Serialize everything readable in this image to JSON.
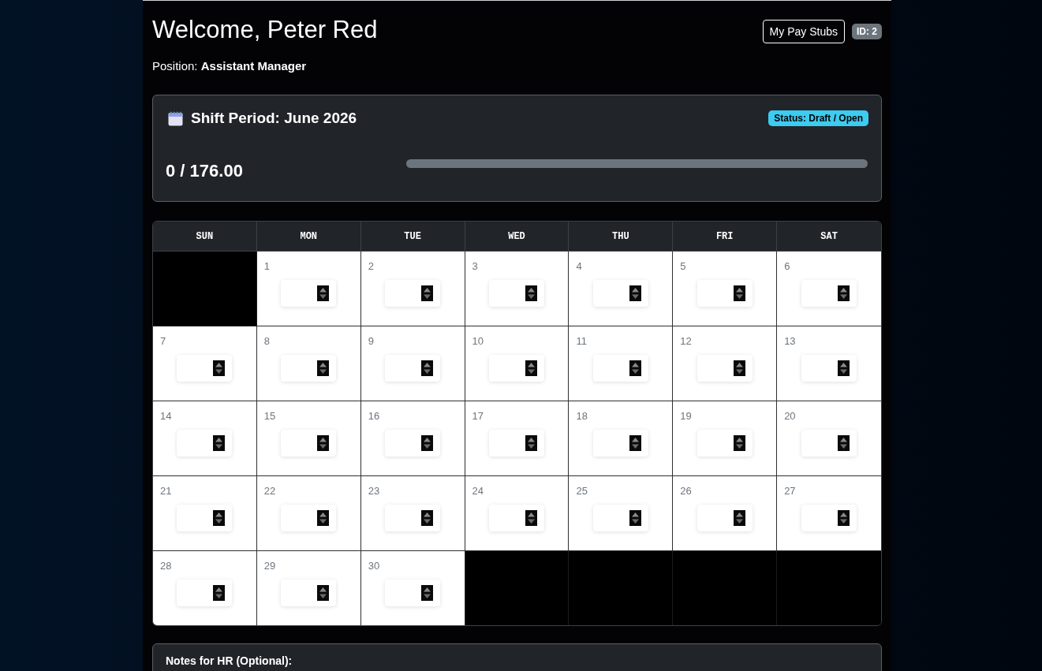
{
  "header": {
    "title": "Welcome, Peter Red",
    "position": "Position: **Assistant Manager**",
    "pay_stubs_button": "My Pay Stubs",
    "id_badge": "ID: 2"
  },
  "shift_card": {
    "title": "Shift Period: June 2026",
    "status": "Status: Draft / Open",
    "hours": "0 / 176.00",
    "progress": {
      "level": 0
    }
  },
  "calendar": {
    "weekdays": [
      "SUN",
      "MON",
      "TUE",
      "WED",
      "THU",
      "FRI",
      "SAT"
    ],
    "weeks": [
      [
        {
          "kind": "blank"
        },
        {
          "kind": "day",
          "day": "1"
        },
        {
          "kind": "day",
          "day": "2"
        },
        {
          "kind": "day",
          "day": "3"
        },
        {
          "kind": "day",
          "day": "4"
        },
        {
          "kind": "day",
          "day": "5"
        },
        {
          "kind": "day",
          "day": "6"
        }
      ],
      [
        {
          "kind": "day",
          "day": "7"
        },
        {
          "kind": "day",
          "day": "8"
        },
        {
          "kind": "day",
          "day": "9"
        },
        {
          "kind": "day",
          "day": "10"
        },
        {
          "kind": "day",
          "day": "11"
        },
        {
          "kind": "day",
          "day": "12"
        },
        {
          "kind": "day",
          "day": "13"
        }
      ],
      [
        {
          "kind": "day",
          "day": "14"
        },
        {
          "kind": "day",
          "day": "15"
        },
        {
          "kind": "day",
          "day": "16"
        },
        {
          "kind": "day",
          "day": "17"
        },
        {
          "kind": "day",
          "day": "18"
        },
        {
          "kind": "day",
          "day": "19"
        },
        {
          "kind": "day",
          "day": "20"
        }
      ],
      [
        {
          "kind": "day",
          "day": "21"
        },
        {
          "kind": "day",
          "day": "22"
        },
        {
          "kind": "day",
          "day": "23"
        },
        {
          "kind": "day",
          "day": "24"
        },
        {
          "kind": "day",
          "day": "25"
        },
        {
          "kind": "day",
          "day": "26"
        },
        {
          "kind": "day",
          "day": "27"
        }
      ],
      [
        {
          "kind": "day",
          "day": "28"
        },
        {
          "kind": "day",
          "day": "29"
        },
        {
          "kind": "day",
          "day": "30"
        },
        {
          "kind": "blank"
        },
        {
          "kind": "blank"
        },
        {
          "kind": "blank"
        },
        {
          "kind": "blank"
        }
      ]
    ]
  },
  "notes": {
    "label": "Notes for HR (Optional):"
  }
}
